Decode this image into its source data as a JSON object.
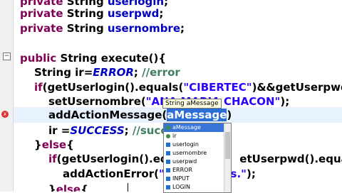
{
  "editor": {
    "lines": {
      "l1": {
        "kw": "private",
        "type": " String ",
        "field": "userlogin",
        "end": ";"
      },
      "l2": {
        "kw": "private",
        "type": " String ",
        "field": "userpwd",
        "end": ";"
      },
      "l3": {
        "kw": "private",
        "type": " String ",
        "field": "usernombre",
        "end": ";"
      },
      "l4": {
        "kw": "public",
        "rest": " String execute(){"
      },
      "l5": {
        "pre": "String ir=",
        "const": "ERROR",
        "mid": "; ",
        "comment": "//error"
      },
      "l6": {
        "kw": "if",
        "pre": "(getUserlogin().equals(",
        "str": "\"CIBERTEC\"",
        "post": ")&&getUserpwd("
      },
      "l7": {
        "pre": "setUsernombre(",
        "str": "\"ANA MARIA CHACON\"",
        "post": ");"
      },
      "l8": {
        "pre": "addActionMessage(",
        "sel": "aMessage",
        "post": ")"
      },
      "l9": {
        "pre": "ir =",
        "const": "SUCCESS",
        "mid": "; ",
        "comment": "//succe"
      },
      "l10": {
        "pre": "}",
        "kw": "else",
        "post": "{"
      },
      "l11": {
        "kw": "if",
        "pre": "(getUserlogin().equ",
        "post": "etUserpwd().equals"
      },
      "l12": {
        "pre": "addActionError(",
        "str": "\"        r datos.\"",
        "post": ");"
      },
      "l13": {
        "pre": "}",
        "kw": "else",
        "post": "{"
      }
    }
  },
  "assist": {
    "tooltip": "String aMessage",
    "items": [
      "aMessage",
      "ir",
      "userlogin",
      "usernombre",
      "userpwd",
      "ERROR",
      "INPUT",
      "LOGIN"
    ]
  }
}
